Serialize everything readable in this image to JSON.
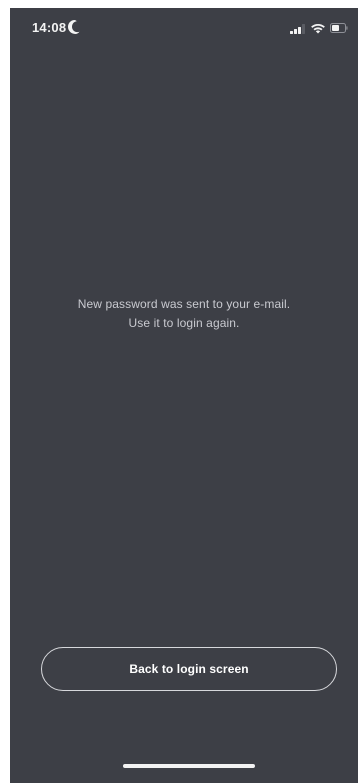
{
  "status_bar": {
    "time": "14:08",
    "moon_icon": "moon-icon",
    "signal_icon": "cellular-signal-icon",
    "wifi_icon": "wifi-icon",
    "battery_icon": "battery-icon"
  },
  "message": {
    "line1": "New password was sent to your e-mail.",
    "line2": "Use it to login again."
  },
  "actions": {
    "back_button_label": "Back to login screen"
  },
  "colors": {
    "background": "#3d3f46",
    "text": "#c9cad0",
    "button_border": "#d7d8dc",
    "button_text": "#ffffff"
  }
}
